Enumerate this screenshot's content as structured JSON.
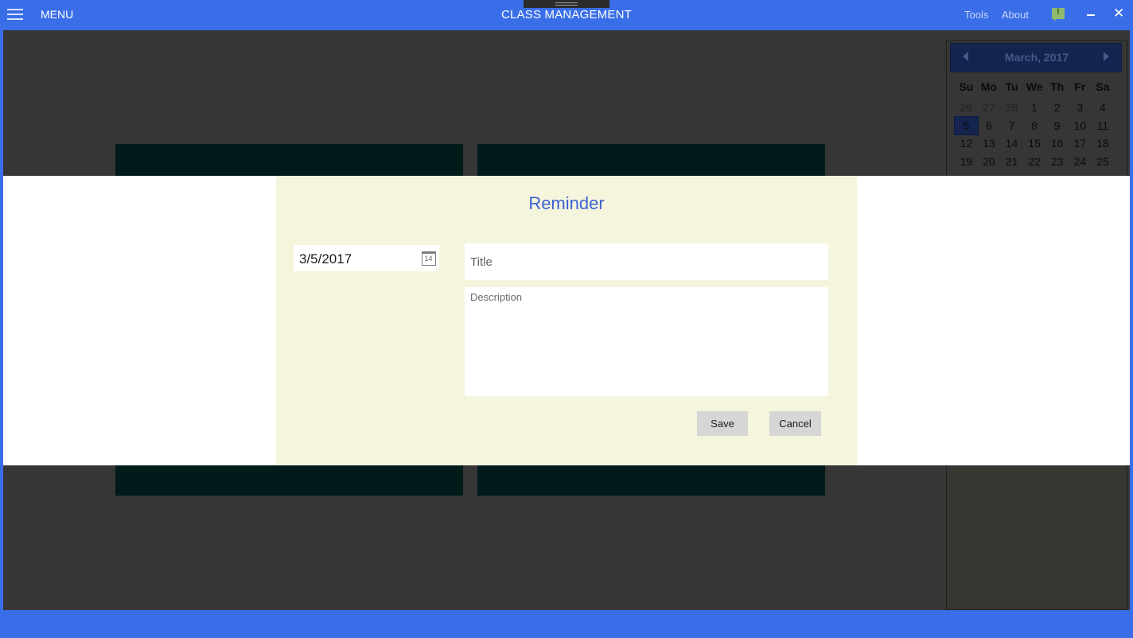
{
  "titlebar": {
    "menu_label": "MENU",
    "app_title": "CLASS MANAGEMENT",
    "tools_label": "Tools",
    "about_label": "About",
    "close_glyph": "✕"
  },
  "calendar": {
    "month_label": "March, 2017",
    "weekdays": [
      "Su",
      "Mo",
      "Tu",
      "We",
      "Th",
      "Fr",
      "Sa"
    ],
    "weeks": [
      [
        "26",
        "27",
        "28",
        "1",
        "2",
        "3",
        "4"
      ],
      [
        "5",
        "6",
        "7",
        "8",
        "9",
        "10",
        "11"
      ],
      [
        "12",
        "13",
        "14",
        "15",
        "16",
        "17",
        "18"
      ],
      [
        "19",
        "20",
        "21",
        "22",
        "23",
        "24",
        "25"
      ]
    ],
    "selected_day": "5"
  },
  "dialog": {
    "title": "Reminder",
    "date_value": "3/5/2017",
    "date_icon_day": "14",
    "title_placeholder": "Title",
    "description_placeholder": "Description",
    "save_label": "Save",
    "cancel_label": "Cancel"
  },
  "colors": {
    "accent": "#3a6ee8",
    "dialog_bg": "#f5f5de",
    "dialog_title": "#3c62d2",
    "tile": "#011b1a"
  }
}
